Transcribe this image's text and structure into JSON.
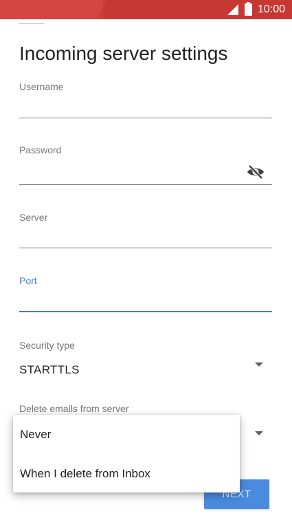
{
  "status_bar": {
    "time": "10:00",
    "signal_icon": "signal-icon",
    "battery_icon": "battery-icon",
    "color": "#d23c36"
  },
  "page": {
    "title": "Incoming server settings"
  },
  "fields": {
    "username": {
      "label": "Username",
      "value": ""
    },
    "password": {
      "label": "Password",
      "value": "",
      "toggle_icon": "visibility-off-icon"
    },
    "server": {
      "label": "Server",
      "value": ""
    },
    "port": {
      "label": "Port",
      "value": "",
      "focused": true,
      "accent": "#3f7fd8"
    }
  },
  "security": {
    "label": "Security type",
    "value": "STARTTLS"
  },
  "delete_emails": {
    "label": "Delete emails from server",
    "options": [
      "Never",
      "When I delete from Inbox"
    ]
  },
  "next_button": {
    "label": "NEXT",
    "color": "#4a8be0"
  }
}
